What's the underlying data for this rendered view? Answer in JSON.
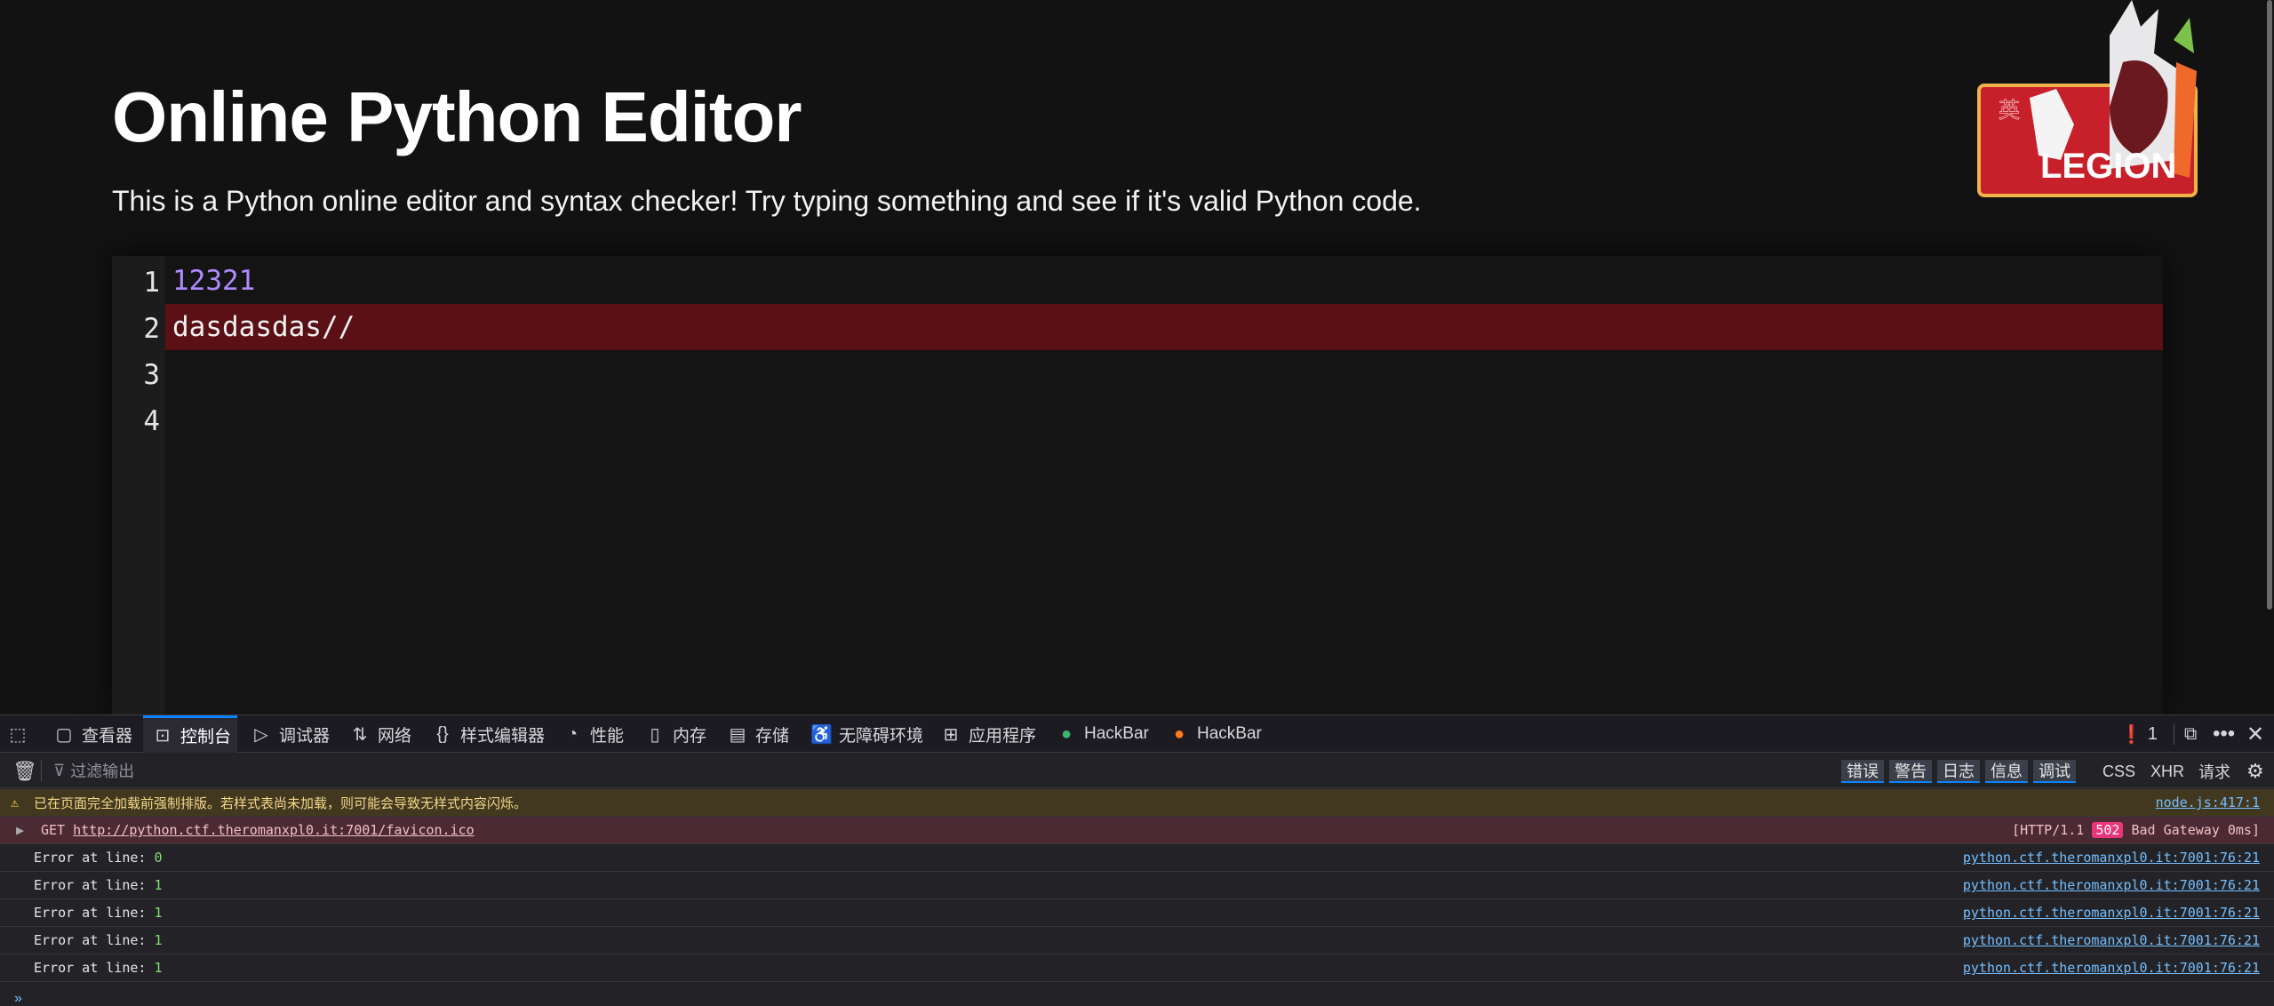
{
  "page": {
    "title": "Online Python Editor",
    "subtitle": "This is a Python online editor and syntax checker! Try typing something and see if it's valid Python code.",
    "logo": {
      "text": "LEGION",
      "kanji": "英"
    }
  },
  "editor": {
    "lines": [
      {
        "num": "1",
        "code": "12321",
        "error": false
      },
      {
        "num": "2",
        "code": "dasdasdas//",
        "error": true
      },
      {
        "num": "3",
        "code": "",
        "error": false
      },
      {
        "num": "4",
        "code": "",
        "error": false
      }
    ]
  },
  "devtools": {
    "tabs": [
      {
        "label": "查看器",
        "icon": "inspector-icon"
      },
      {
        "label": "控制台",
        "icon": "console-icon",
        "active": true
      },
      {
        "label": "调试器",
        "icon": "debugger-icon"
      },
      {
        "label": "网络",
        "icon": "network-icon"
      },
      {
        "label": "样式编辑器",
        "icon": "style-editor-icon"
      },
      {
        "label": "性能",
        "icon": "performance-icon"
      },
      {
        "label": "内存",
        "icon": "memory-icon"
      },
      {
        "label": "存储",
        "icon": "storage-icon"
      },
      {
        "label": "无障碍环境",
        "icon": "accessibility-icon"
      },
      {
        "label": "应用程序",
        "icon": "application-icon"
      },
      {
        "label": "HackBar",
        "icon": "hackbar-green-icon"
      },
      {
        "label": "HackBar",
        "icon": "hackbar-firefox-icon"
      }
    ],
    "error_count": "1",
    "filter_placeholder": "过滤输出",
    "levels": [
      "错误",
      "警告",
      "日志",
      "信息",
      "调试"
    ],
    "types": [
      "CSS",
      "XHR",
      "请求"
    ],
    "logs": {
      "warning": {
        "text": "已在页面完全加载前强制排版。若样式表尚未加载，则可能会导致无样式内容闪烁。",
        "source": "node.js:417:1"
      },
      "network": {
        "method": "GET",
        "url": "http://python.ctf.theromanxpl0.it:7001/favicon.ico",
        "status_pre": "[HTTP/1.1",
        "status_code": "502",
        "status_post": "Bad Gateway 0ms]"
      },
      "errors": [
        {
          "text": "Error at line:",
          "line": "0",
          "source": "python.ctf.theromanxpl0.it:7001:76:21"
        },
        {
          "text": "Error at line:",
          "line": "1",
          "source": "python.ctf.theromanxpl0.it:7001:76:21"
        },
        {
          "text": "Error at line:",
          "line": "1",
          "source": "python.ctf.theromanxpl0.it:7001:76:21"
        },
        {
          "text": "Error at line:",
          "line": "1",
          "source": "python.ctf.theromanxpl0.it:7001:76:21"
        },
        {
          "text": "Error at line:",
          "line": "1",
          "source": "python.ctf.theromanxpl0.it:7001:76:21"
        }
      ]
    },
    "colors": {
      "accent": "#0a84ff",
      "error_line": "#5a1014",
      "number_token": "#b08bff"
    }
  }
}
